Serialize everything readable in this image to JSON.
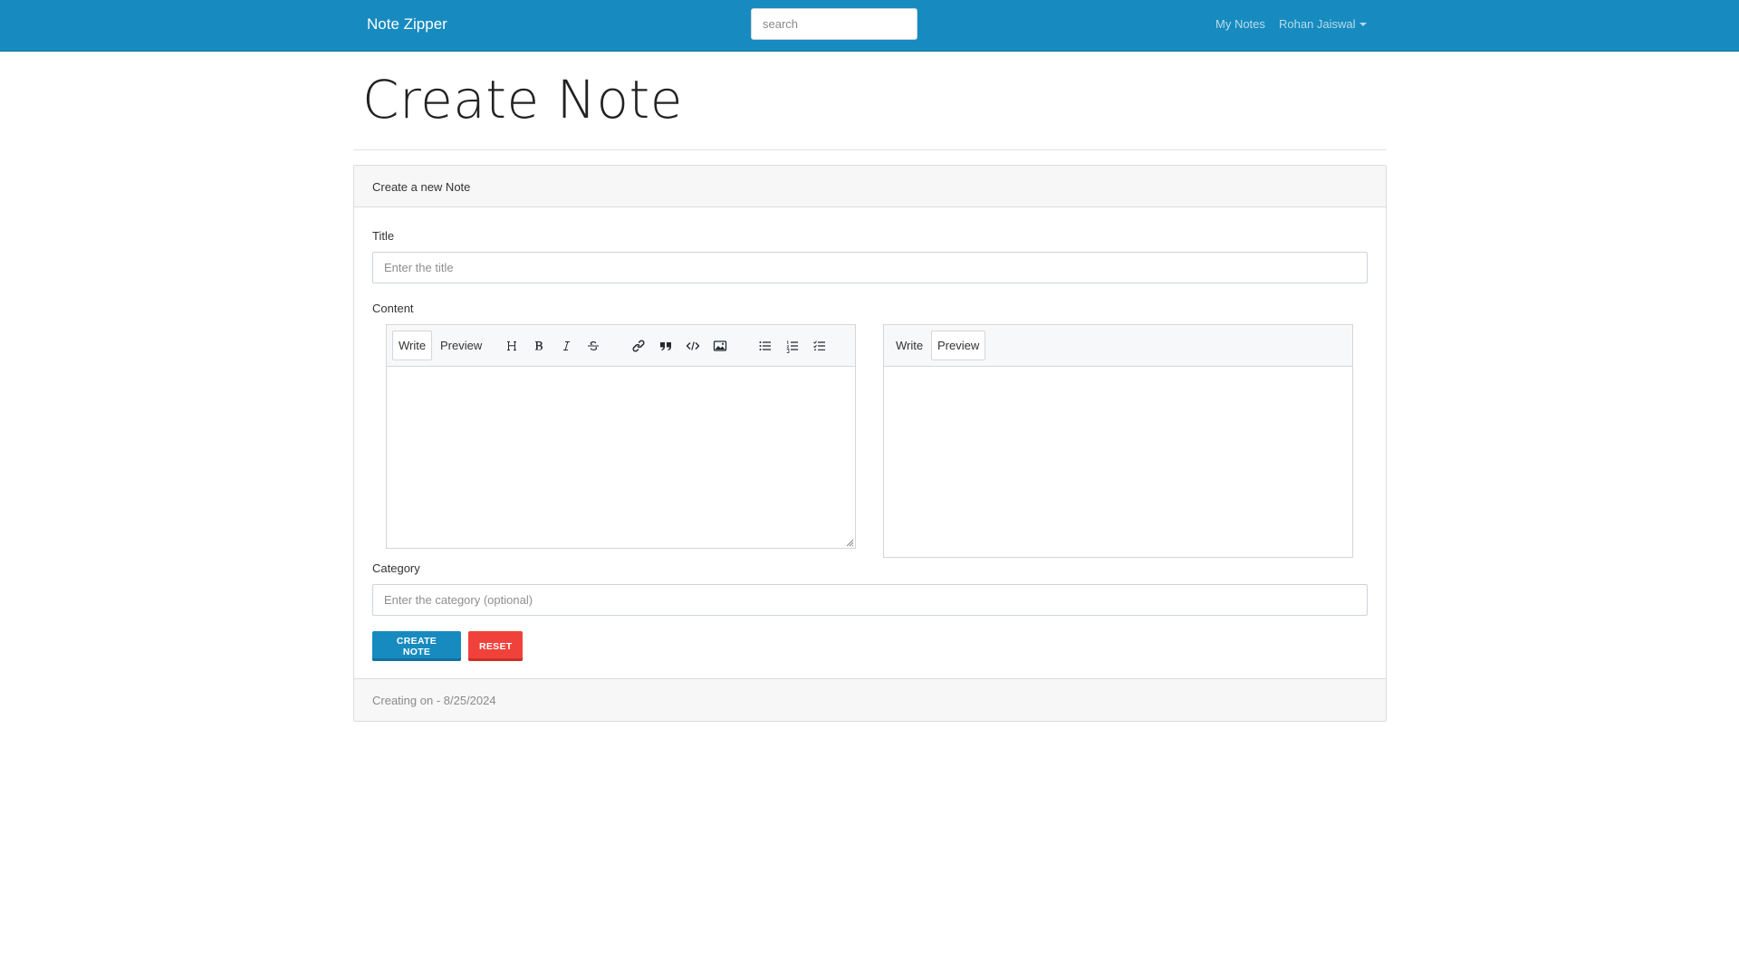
{
  "navbar": {
    "brand": "Note Zipper",
    "search_placeholder": "search",
    "my_notes": "My Notes",
    "user_name": "Rohan Jaiswal",
    "background": "#178bbf"
  },
  "page": {
    "title": "Create Note"
  },
  "card": {
    "header": "Create a new Note",
    "title_label": "Title",
    "title_placeholder": "Enter the title",
    "content_label": "Content",
    "category_label": "Category",
    "category_placeholder": "Enter the category (optional)",
    "footer": "Creating on - 8/25/2024"
  },
  "editor_left": {
    "tabs": [
      "Write",
      "Preview"
    ],
    "active_tab": "Write",
    "tools": [
      "heading-icon",
      "bold-icon",
      "italic-icon",
      "strikethrough-icon",
      "link-icon",
      "quote-icon",
      "code-icon",
      "image-icon",
      "bulleted-list-icon",
      "numbered-list-icon",
      "checked-list-icon"
    ]
  },
  "editor_right": {
    "tabs": [
      "Write",
      "Preview"
    ],
    "active_tab": "Preview"
  },
  "buttons": {
    "create": "CREATE NOTE",
    "reset": "RESET",
    "create_color": "#178bbf",
    "reset_color": "#f0423b"
  }
}
